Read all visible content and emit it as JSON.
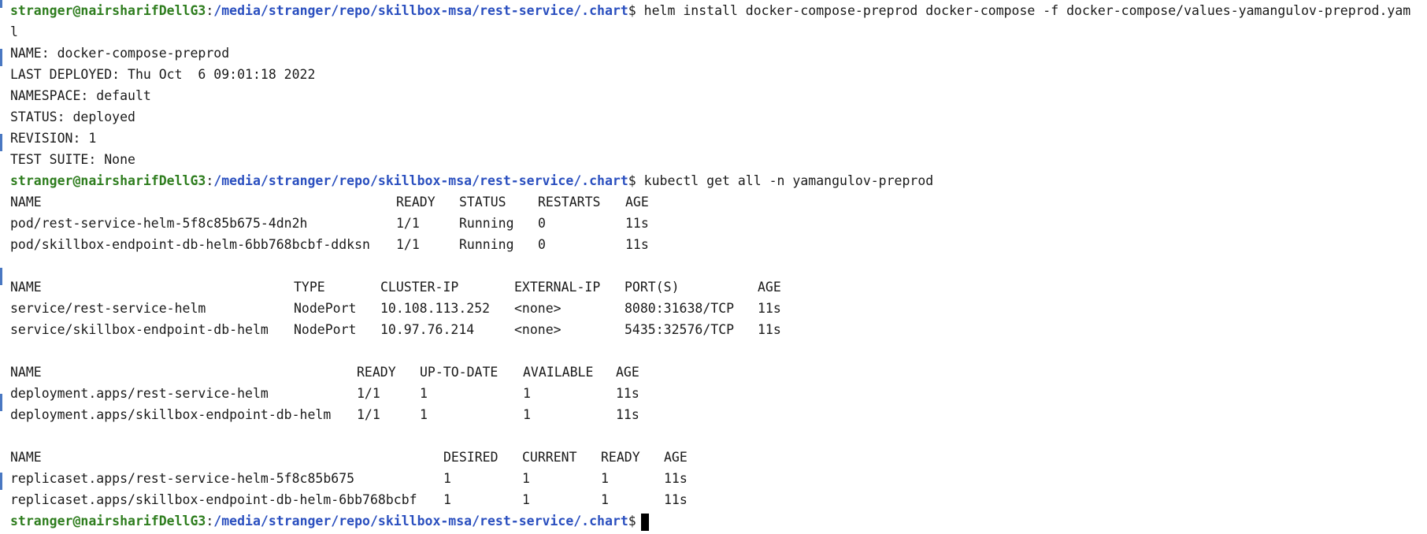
{
  "prompt": {
    "user_host": "stranger@nairsharifDellG3",
    "separator": ":",
    "path": "/media/stranger/repo/skillbox-msa/rest-service/.chart",
    "symbol": "$"
  },
  "commands": {
    "helm_install": "helm install docker-compose-preprod docker-compose -f docker-compose/values-yamangulov-preprod.yam",
    "helm_install_wrap": "l",
    "kubectl_get": "kubectl get all -n yamangulov-preprod"
  },
  "helm_output": [
    "NAME: docker-compose-preprod",
    "LAST DEPLOYED: Thu Oct  6 09:01:18 2022",
    "NAMESPACE: default",
    "STATUS: deployed",
    "REVISION: 1",
    "TEST SUITE: None"
  ],
  "pods": {
    "headers": [
      "NAME",
      "READY",
      "STATUS",
      "RESTARTS",
      "AGE"
    ],
    "rows": [
      [
        "pod/rest-service-helm-5f8c85b675-4dn2h",
        "1/1",
        "Running",
        "0",
        "11s"
      ],
      [
        "pod/skillbox-endpoint-db-helm-6bb768bcbf-ddksn",
        "1/1",
        "Running",
        "0",
        "11s"
      ]
    ]
  },
  "services": {
    "headers": [
      "NAME",
      "TYPE",
      "CLUSTER-IP",
      "EXTERNAL-IP",
      "PORT(S)",
      "AGE"
    ],
    "rows": [
      [
        "service/rest-service-helm",
        "NodePort",
        "10.108.113.252",
        "<none>",
        "8080:31638/TCP",
        "11s"
      ],
      [
        "service/skillbox-endpoint-db-helm",
        "NodePort",
        "10.97.76.214",
        "<none>",
        "5435:32576/TCP",
        "11s"
      ]
    ]
  },
  "deployments": {
    "headers": [
      "NAME",
      "READY",
      "UP-TO-DATE",
      "AVAILABLE",
      "AGE"
    ],
    "rows": [
      [
        "deployment.apps/rest-service-helm",
        "1/1",
        "1",
        "1",
        "11s"
      ],
      [
        "deployment.apps/skillbox-endpoint-db-helm",
        "1/1",
        "1",
        "1",
        "11s"
      ]
    ]
  },
  "replicasets": {
    "headers": [
      "NAME",
      "DESIRED",
      "CURRENT",
      "READY",
      "AGE"
    ],
    "rows": [
      [
        "replicaset.apps/rest-service-helm-5f8c85b675",
        "1",
        "1",
        "1",
        "11s"
      ],
      [
        "replicaset.apps/skillbox-endpoint-db-helm-6bb768bcbf",
        "1",
        "1",
        "1",
        "11s"
      ]
    ]
  },
  "colors": {
    "user_host": "#2e7d1e",
    "path": "#2a4fbf",
    "text": "#1a1a1a",
    "gutter_accent": "#4a78c2"
  }
}
